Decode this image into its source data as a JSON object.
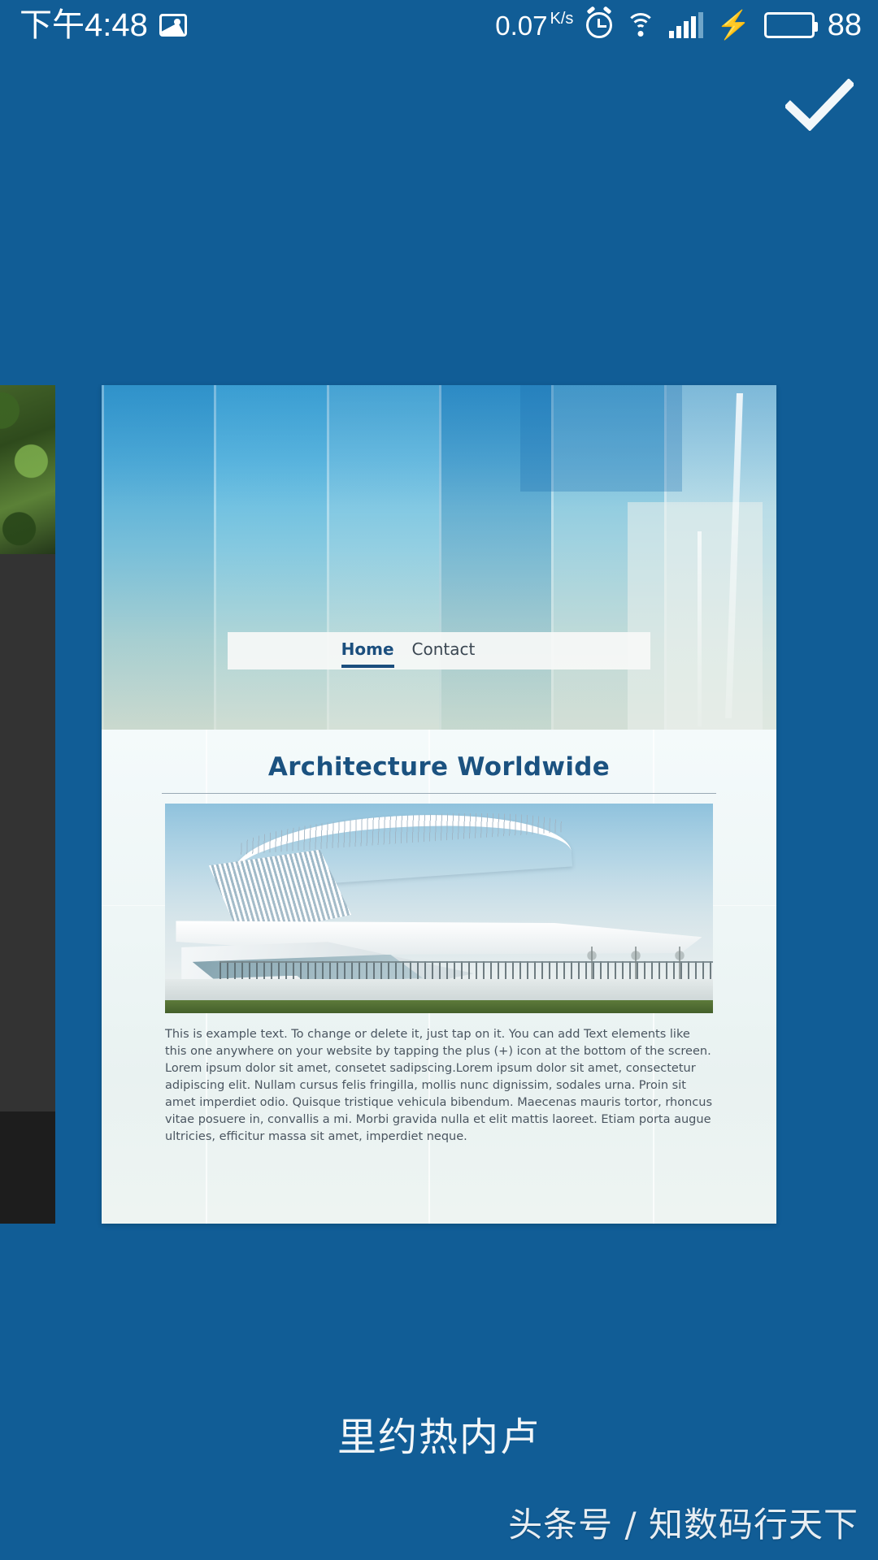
{
  "theme": {
    "background": "#115D96",
    "accent": "#1b5280",
    "battery_green": "#22C522",
    "card_bg": "#ffffff",
    "prev_card_bg": "#333333"
  },
  "status_bar": {
    "clock": "下午4:48",
    "screenshot_icon": "picture-icon",
    "net_rate_value": "0.07",
    "net_rate_unit_top": "K",
    "net_rate_unit_bottom": "s",
    "alarm_icon": "alarm-clock-icon",
    "wifi_icon": "wifi-icon",
    "signal_icon": "cellular-signal-icon",
    "charging_icon": "lightning-bolt-icon",
    "battery_icon": "battery-icon",
    "battery_percent": "88"
  },
  "action_bar": {
    "confirm_label": "check-icon"
  },
  "carousel": {
    "previous_card": {
      "name": "previous-preview-card",
      "photo_alt": "green-foliage-photo"
    },
    "current_card": {
      "hero_alt": "blue-glass-facade-photo",
      "nav": {
        "items": [
          {
            "label": "Home",
            "active": true
          },
          {
            "label": "Contact",
            "active": false
          }
        ]
      },
      "page_title": "Architecture Worldwide",
      "photo_alt": "milwaukee-art-museum-photo",
      "body_text": "This is example text. To change or delete it, just tap on it. You can add Text elements like this one anywhere on your website by tapping the plus (+) icon at the bottom of the screen. Lorem ipsum dolor sit amet, consetet sadipscing.Lorem ipsum dolor sit amet, consectetur adipiscing elit. Nullam cursus felis fringilla, mollis nunc dignissim, sodales urna. Proin sit amet imperdiet odio. Quisque tristique vehicula bibendum. Maecenas mauris tortor, rhoncus vitae posuere in, convallis a mi. Morbi gravida nulla et elit mattis laoreet. Etiam porta augue ultricies, efficitur massa sit amet, imperdiet neque."
    }
  },
  "footer": {
    "caption": "里约热内卢",
    "watermark": "头条号 / 知数码行天下"
  }
}
